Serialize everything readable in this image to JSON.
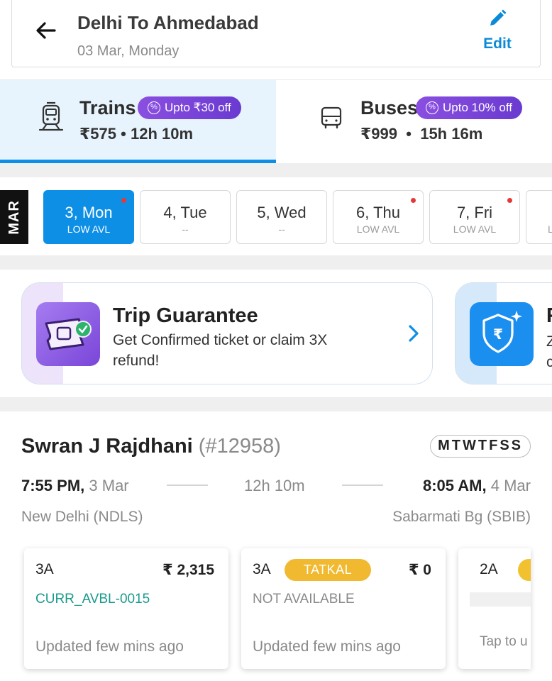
{
  "header": {
    "title": "Delhi To Ahmedabad",
    "date": "03 Mar, Monday",
    "edit_label": "Edit"
  },
  "modes": [
    {
      "name": "Trains",
      "offer": "Upto ₹30 off",
      "price": "₹575",
      "duration": "12h 10m",
      "active": true
    },
    {
      "name": "Buses",
      "offer": "Upto 10% off",
      "price": "₹999",
      "duration": "15h 16m",
      "active": false
    }
  ],
  "dates": {
    "month": "MAR",
    "items": [
      {
        "day": "3, Mon",
        "avail": "LOW AVL",
        "selected": true,
        "dot": true
      },
      {
        "day": "4, Tue",
        "avail": "--",
        "selected": false,
        "dot": false
      },
      {
        "day": "5, Wed",
        "avail": "--",
        "selected": false,
        "dot": false
      },
      {
        "day": "6, Thu",
        "avail": "LOW AVL",
        "selected": false,
        "dot": true
      },
      {
        "day": "7, Fri",
        "avail": "LOW AVL",
        "selected": false,
        "dot": true
      },
      {
        "day": "",
        "avail": "L",
        "selected": false,
        "dot": false
      }
    ]
  },
  "promos": [
    {
      "title": "Trip Guarantee",
      "subtitle": "Get Confirmed ticket or claim 3X refund!"
    },
    {
      "title": "F",
      "subtitle": "Z\nc"
    }
  ],
  "train": {
    "name": "Swran J Rajdhani",
    "number": "(#12958)",
    "days": "MTWTFSS",
    "departure_time": "7:55 PM,",
    "departure_date": "3 Mar",
    "duration": "12h 10m",
    "arrival_time": "8:05 AM,",
    "arrival_date": "4 Mar",
    "from_station": "New Delhi (NDLS)",
    "to_station": "Sabarmati Bg (SBIB)",
    "classes": [
      {
        "class": "3A",
        "price": "₹ 2,315",
        "quota": "",
        "availability": "CURR_AVBL-0015",
        "updated": "Updated few mins ago"
      },
      {
        "class": "3A",
        "price": "₹ 0",
        "quota": "TATKAL",
        "availability": "NOT AVAILABLE",
        "updated": "Updated few mins ago"
      },
      {
        "class": "2A",
        "price": "",
        "quota": "",
        "availability": "",
        "updated": "Tap to u"
      }
    ]
  },
  "colors": {
    "accent": "#0d8fe6",
    "offer_purple": "#7a46d8",
    "tatkal": "#f1b930",
    "available_green": "#1a9a8c",
    "alert_red": "#e53935"
  }
}
